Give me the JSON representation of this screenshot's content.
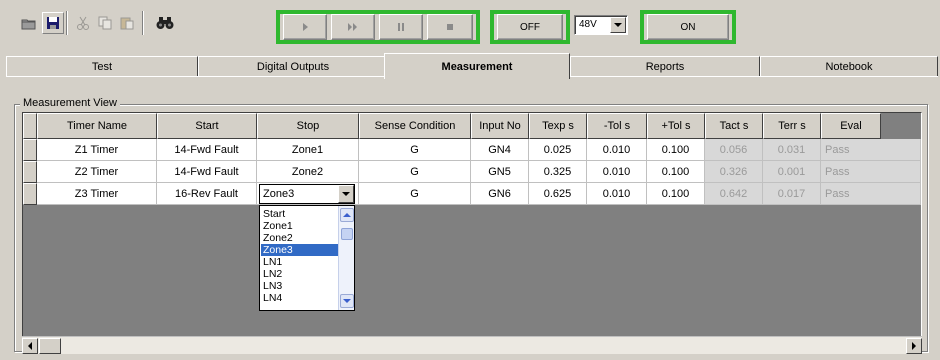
{
  "toolbar": {
    "icons": [
      "open-icon",
      "save-icon",
      "cut-icon",
      "copy-icon",
      "paste-icon",
      "binoculars-icon"
    ],
    "run_controls": [
      "play-icon",
      "fast-forward-icon",
      "pause-icon",
      "stop-icon"
    ],
    "off_label": "OFF",
    "voltage_value": "48V",
    "on_label": "ON",
    "highlight_color": "#2fb82f"
  },
  "tabs": [
    {
      "label": "Test",
      "active": false
    },
    {
      "label": "Digital Outputs",
      "active": false
    },
    {
      "label": "Measurement",
      "active": true
    },
    {
      "label": "Reports",
      "active": false
    },
    {
      "label": "Notebook",
      "active": false
    }
  ],
  "group_title": "Measurement View",
  "table": {
    "columns": [
      "Timer Name",
      "Start",
      "Stop",
      "Sense Condition",
      "Input No",
      "Texp s",
      "-Tol s",
      "+Tol s",
      "Tact s",
      "Terr s",
      "Eval"
    ],
    "rows": [
      [
        "Z1 Timer",
        "14-Fwd Fault",
        "Zone1",
        "G",
        "GN4",
        "0.025",
        "0.010",
        "0.100",
        "0.056",
        "0.031",
        "Pass"
      ],
      [
        "Z2 Timer",
        "14-Fwd Fault",
        "Zone2",
        "G",
        "GN5",
        "0.325",
        "0.010",
        "0.100",
        "0.326",
        "0.001",
        "Pass"
      ],
      [
        "Z3 Timer",
        "16-Rev Fault",
        "Zone3",
        "G",
        "GN6",
        "0.625",
        "0.010",
        "0.100",
        "0.642",
        "0.017",
        "Pass"
      ]
    ]
  },
  "stop_dropdown": {
    "current": "Zone3",
    "options": [
      "Start",
      "Zone1",
      "Zone2",
      "Zone3",
      "LN1",
      "LN2",
      "LN3",
      "LN4"
    ],
    "selected": "Zone3"
  }
}
